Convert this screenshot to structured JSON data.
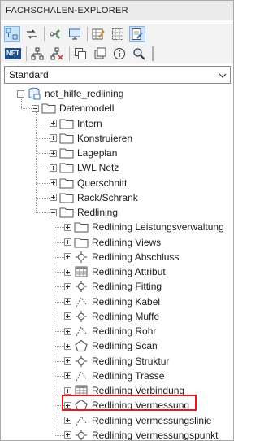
{
  "panel": {
    "title": "FACHSCHALEN-EXPLORER"
  },
  "toolbar1": {
    "buttons": [
      {
        "icon": "tree-view-icon",
        "active": true
      },
      {
        "icon": "refresh-arrows-icon",
        "active": false
      },
      {
        "icon": "filter-network-icon",
        "active": false
      },
      {
        "icon": "monitor-icon",
        "active": false
      },
      {
        "icon": "edit-grid-icon",
        "active": false
      },
      {
        "icon": "select-grid-icon",
        "active": false
      },
      {
        "icon": "edit-document-icon",
        "active": true
      }
    ]
  },
  "toolbar2": {
    "net_label": "NET",
    "buttons": [
      {
        "icon": "hierarchy-icon"
      },
      {
        "icon": "hierarchy-delete-icon"
      },
      {
        "icon": "copy-icon"
      },
      {
        "icon": "layers-icon"
      },
      {
        "icon": "info-icon"
      },
      {
        "icon": "search-icon"
      }
    ]
  },
  "dropdown": {
    "value": "Standard"
  },
  "tree": {
    "root": "net_hilfe_redlining",
    "datenmodell": "Datenmodell",
    "categories": [
      "Intern",
      "Konstruieren",
      "Lageplan",
      "LWL Netz",
      "Querschnitt",
      "Rack/Schrank"
    ],
    "redlining": "Redlining",
    "redlining_children": [
      {
        "label": "Redlining Leistungsverwaltung",
        "icon": "folder"
      },
      {
        "label": "Redlining Views",
        "icon": "folder"
      },
      {
        "label": "Redlining Abschluss",
        "icon": "node"
      },
      {
        "label": "Redlining Attribut",
        "icon": "table"
      },
      {
        "label": "Redlining Fitting",
        "icon": "node"
      },
      {
        "label": "Redlining Kabel",
        "icon": "line"
      },
      {
        "label": "Redlining Muffe",
        "icon": "node"
      },
      {
        "label": "Redlining Rohr",
        "icon": "line"
      },
      {
        "label": "Redlining Scan",
        "icon": "pentagon"
      },
      {
        "label": "Redlining Struktur",
        "icon": "node"
      },
      {
        "label": "Redlining Trasse",
        "icon": "line"
      },
      {
        "label": "Redlining Verbindung",
        "icon": "table"
      },
      {
        "label": "Redlining Vermessung",
        "icon": "pentagon"
      },
      {
        "label": "Redlining Vermessungslinie",
        "icon": "line"
      },
      {
        "label": "Redlining Vermessungspunkt",
        "icon": "node"
      }
    ],
    "selected": "Redlining Vermessung"
  }
}
